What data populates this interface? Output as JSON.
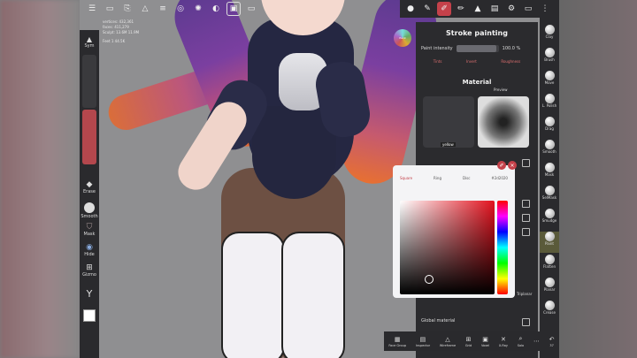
{
  "top_toolbar": {
    "icons": [
      "menu-icon",
      "folder-icon",
      "scene-icon",
      "wireframe-icon",
      "layers-icon",
      "settings-icon",
      "camera-icon",
      "image-icon",
      "video-icon"
    ]
  },
  "stats": {
    "line1": "vertices: 432,361",
    "line2": "faces: 411,279",
    "line3": "Sculpt: 13.6M",
    "line4": "11.9M",
    "subline": "Feet 1",
    "subcount": "44.5K"
  },
  "left_tools": {
    "sym_label": "Sym",
    "erase_label": "Erase",
    "smooth_label": "Smooth",
    "mask_label": "Mask",
    "hide_label": "Hide",
    "gizmo_label": "Gizmo"
  },
  "right_tools": {
    "items": [
      "Clay",
      "Brush",
      "Move",
      "L. Polish",
      "Drag",
      "Smooth",
      "Mask",
      "SelMask",
      "Smudge",
      "Paint",
      "Flatten",
      "Planar",
      "Crease"
    ],
    "active": "Paint"
  },
  "panel": {
    "title": "Stroke painting",
    "intensity_label": "Paint intensity",
    "intensity_value": "100.0 %",
    "intensity_fraction": 0.95,
    "modes": [
      "Tints",
      "Invert",
      "Roughness"
    ],
    "material_title": "Material",
    "preview_label": "Preview",
    "thumb_label": "yellow",
    "global_material": "Global material"
  },
  "color_picker": {
    "tabs": [
      "Square",
      "Ring",
      "Disc",
      "#2d2020"
    ],
    "active_tab": "Square",
    "planar_label": "Triplanar"
  },
  "avatar": {
    "label": "Paint"
  },
  "bottom_toolbar": [
    {
      "icon": "face-group-icon",
      "label": "Face Group"
    },
    {
      "icon": "inspector-icon",
      "label": "Inspector"
    },
    {
      "icon": "wireframe-icon",
      "label": "Wireframe"
    },
    {
      "icon": "grid-icon",
      "label": "Grid"
    },
    {
      "icon": "voxel-icon",
      "label": "Voxel"
    },
    {
      "icon": "xray-icon",
      "label": "X-Ray"
    },
    {
      "icon": "solo-icon",
      "label": "Solo"
    },
    {
      "icon": "more-icon",
      "label": ""
    },
    {
      "icon": "undo-icon",
      "label": "37"
    }
  ],
  "colors": {
    "accent": "#c4414a",
    "panel_bg": "#2b2b2e",
    "viewport_bg": "#8f8f91"
  }
}
